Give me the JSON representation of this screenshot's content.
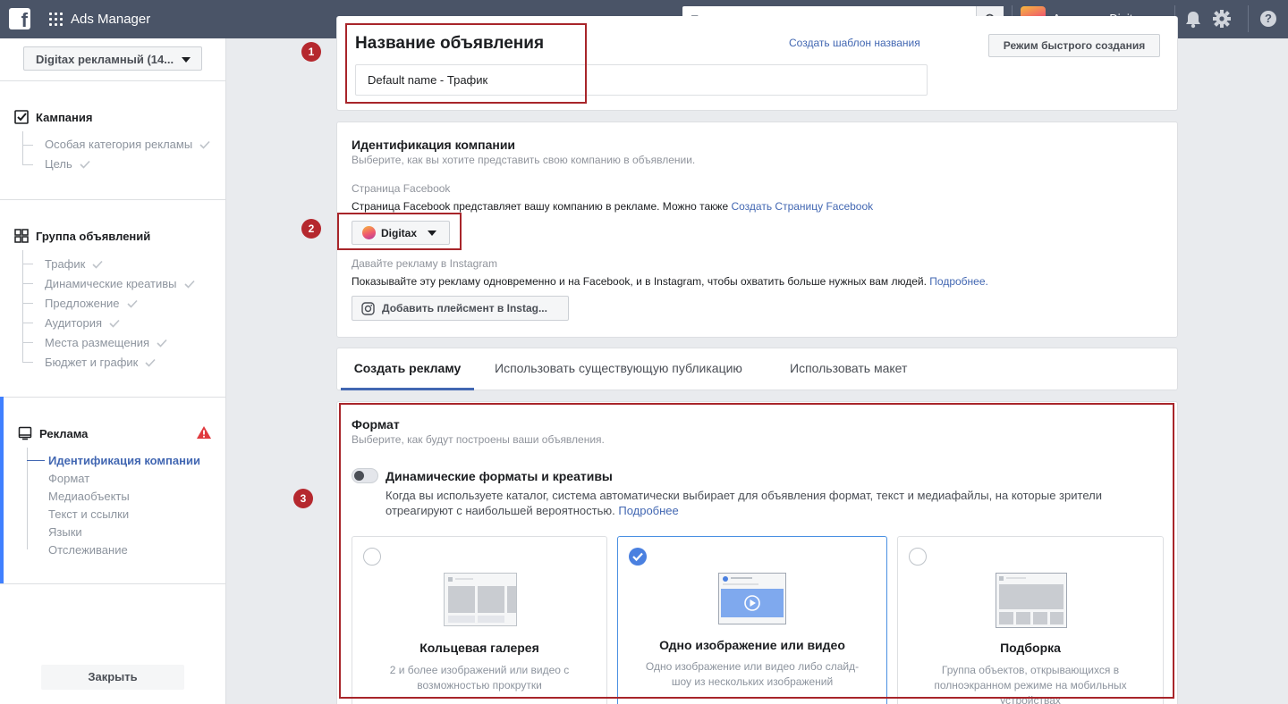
{
  "topbar": {
    "logo": "f",
    "app_title": "Ads Manager",
    "search_placeholder": "Поиск в компании",
    "agency_name": "Агентство Digitax",
    "help": "?"
  },
  "sidebar": {
    "account_select": "Digitax рекламный (14...",
    "campaign": {
      "title": "Кампания",
      "items": [
        "Особая категория рекламы",
        "Цель"
      ]
    },
    "adset": {
      "title": "Группа объявлений",
      "items": [
        "Трафик",
        "Динамические креативы",
        "Предложение",
        "Аудитория",
        "Места размещения",
        "Бюджет и график"
      ]
    },
    "ad": {
      "title": "Реклама",
      "items": [
        "Идентификация компании",
        "Формат",
        "Медиаобъекты",
        "Текст и ссылки",
        "Языки",
        "Отслеживание"
      ]
    },
    "close_label": "Закрыть"
  },
  "ad_name": {
    "title": "Название объявления",
    "template_link": "Создать шаблон названия",
    "quick_mode": "Режим быстрого создания",
    "value": "Default name - Трафик"
  },
  "identity": {
    "title": "Идентификация компании",
    "subtitle": "Выберите, как вы хотите представить свою компанию в объявлении.",
    "fb_page_label": "Страница Facebook",
    "fb_page_text": "Страница Facebook представляет вашу компанию в рекламе. Можно также",
    "fb_page_link": "Создать Страницу Facebook",
    "page_name": "Digitax",
    "ig_label": "Давайте рекламу в Instagram",
    "ig_text": "Показывайте эту рекламу одновременно и на Facebook, и в Instagram, чтобы охватить больше нужных вам людей.",
    "ig_link": "Подробнее.",
    "ig_button": "Добавить плейсмент в Instag..."
  },
  "tabs": [
    "Создать рекламу",
    "Использовать существующую публикацию",
    "Использовать макет"
  ],
  "format": {
    "title": "Формат",
    "subtitle": "Выберите, как будут построены ваши объявления.",
    "dynamic_title": "Динамические форматы и креативы",
    "dynamic_desc": "Когда вы используете каталог, система автоматически выбирает для объявления формат, текст и медиафайлы, на которые зрители отреагируют с наибольшей вероятностью.",
    "dynamic_link": "Подробнее",
    "cards": [
      {
        "title": "Кольцевая галерея",
        "desc": "2 и более изображений или видео с возможностью прокрутки"
      },
      {
        "title": "Одно изображение или видео",
        "desc": "Одно изображение или видео либо слайд-шоу из нескольких изображений"
      },
      {
        "title": "Подборка",
        "desc": "Группа объектов, открывающихся в полноэкранном режиме на мобильных устройствах"
      }
    ]
  },
  "annotations": [
    "1",
    "2",
    "3"
  ],
  "colors": {
    "topbar": "#4a5467",
    "link": "#4267b2",
    "annotation_red": "#a8252a",
    "active_blue": "#4080ff"
  }
}
